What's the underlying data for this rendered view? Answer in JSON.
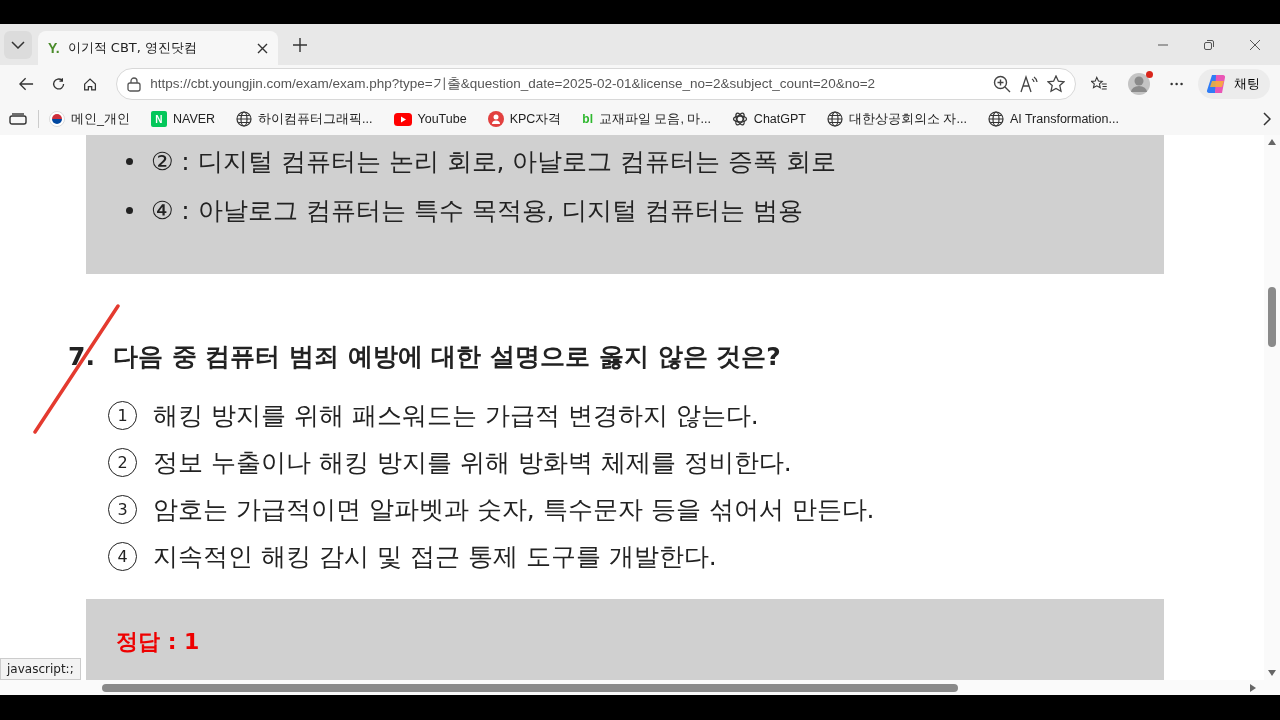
{
  "window": {
    "tab": {
      "title": "이기적 CBT, 영진닷컴",
      "favicon": "Y.",
      "selected": true
    },
    "address": "https://cbt.youngjin.com/exam/exam.php?type=기출&question_date=2025-02-01&license_no=2&subject_count=20&no=2",
    "copilot_label": "채팅",
    "bookmarks": [
      {
        "kind": "flag",
        "label": "메인_개인"
      },
      {
        "kind": "naver",
        "icon_text": "N",
        "label": "NAVER"
      },
      {
        "kind": "globe",
        "label": "하이컴퓨터그래픽..."
      },
      {
        "kind": "youtube",
        "label": "YouTube"
      },
      {
        "kind": "kpc",
        "label": "KPC자격"
      },
      {
        "kind": "bl",
        "icon_text": "bl",
        "label": "교재파일 모음, 마..."
      },
      {
        "kind": "chatgpt",
        "label": "ChatGPT"
      },
      {
        "kind": "globe",
        "label": "대한상공회의소 자..."
      },
      {
        "kind": "globe",
        "label": "AI Transformation..."
      }
    ]
  },
  "page": {
    "explanation": [
      "② : 디지털 컴퓨터는 논리 회로, 아날로그 컴퓨터는 증폭 회로",
      "④ : 아날로그 컴퓨터는 특수 목적용, 디지털 컴퓨터는 범용"
    ],
    "question": {
      "number": "7.",
      "text": "다음 중 컴퓨터 범죄 예방에 대한 설명으로 옳지 않은 것은?",
      "options": [
        {
          "number": "1",
          "text": "해킹 방지를 위해 패스워드는 가급적 변경하지 않는다."
        },
        {
          "number": "2",
          "text": "정보 누출이나 해킹 방지를 위해 방화벽 체제를 정비한다."
        },
        {
          "number": "3",
          "text": "암호는 가급적이면 알파벳과 숫자, 특수문자 등을 섞어서 만든다."
        },
        {
          "number": "4",
          "text": "지속적인 해킹 감시 및 접근 통제 도구를 개발한다."
        }
      ]
    },
    "answer": "정답 : 1"
  },
  "status": "javascript:;"
}
